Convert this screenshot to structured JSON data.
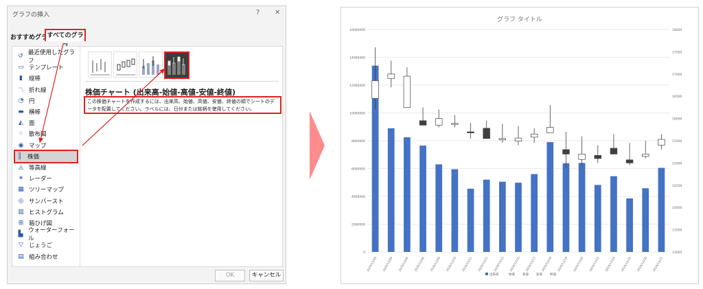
{
  "dialog": {
    "title": "グラフの挿入",
    "help_label": "?",
    "close_label": "✕",
    "tabs": {
      "recommended": "おすすめグラフ",
      "all": "すべてのグラフ"
    },
    "sidebar": [
      {
        "label": "最近使用したグラフ",
        "icon": "recent-icon"
      },
      {
        "label": "テンプレート",
        "icon": "template-icon"
      },
      {
        "label": "縦棒",
        "icon": "column-chart-icon"
      },
      {
        "label": "折れ線",
        "icon": "line-chart-icon"
      },
      {
        "label": "円",
        "icon": "pie-chart-icon"
      },
      {
        "label": "横棒",
        "icon": "bar-chart-icon"
      },
      {
        "label": "面",
        "icon": "area-chart-icon"
      },
      {
        "label": "散布図",
        "icon": "scatter-chart-icon"
      },
      {
        "label": "マップ",
        "icon": "map-chart-icon"
      },
      {
        "label": "株価",
        "icon": "stock-chart-icon"
      },
      {
        "label": "等高線",
        "icon": "surface-chart-icon"
      },
      {
        "label": "レーダー",
        "icon": "radar-chart-icon"
      },
      {
        "label": "ツリーマップ",
        "icon": "treemap-chart-icon"
      },
      {
        "label": "サンバースト",
        "icon": "sunburst-chart-icon"
      },
      {
        "label": "ヒストグラム",
        "icon": "histogram-chart-icon"
      },
      {
        "label": "箱ひげ図",
        "icon": "box-whisker-chart-icon"
      },
      {
        "label": "ウォーターフォール",
        "icon": "waterfall-chart-icon"
      },
      {
        "label": "じょうご",
        "icon": "funnel-chart-icon"
      },
      {
        "label": "組み合わせ",
        "icon": "combo-chart-icon"
      }
    ],
    "selected_category": "株価",
    "subtype_title": "株価チャート (出来高-始値-高値-安値-終値)",
    "description": "この株価チャートを作成するには、出来高、始値、高値、安値、終値の順でシートのデータを配置してください。ラベルには、日付または銘柄を使用してください。",
    "ok_label": "OK",
    "cancel_label": "キャンセル",
    "highlight_color": "#e02020"
  },
  "chart_data": {
    "type": "bar",
    "title": "グラフ タイトル",
    "categories": [
      "2024/12/03",
      "2024/12/04",
      "2024/12/05",
      "2024/12/06",
      "2024/12/09",
      "2024/12/10",
      "2024/12/11",
      "2024/12/12",
      "2024/12/13",
      "2024/12/16",
      "2024/12/17",
      "2024/12/18",
      "2024/12/19",
      "2024/12/20",
      "2024/12/23",
      "2024/12/24",
      "2024/12/25",
      "2024/12/26",
      "2024/12/27"
    ],
    "volume": [
      13400000,
      8900000,
      8250000,
      7650000,
      6300000,
      5950000,
      4550000,
      5200000,
      5050000,
      4980000,
      5600000,
      7900000,
      6380000,
      6400000,
      4820000,
      5450000,
      3850000,
      4580000,
      6050000
    ],
    "open": [
      16450,
      16900,
      16250,
      15950,
      15850,
      15870,
      15700,
      15780,
      15520,
      15490,
      15580,
      15680,
      15300,
      15080,
      15170,
      15330,
      15070,
      15150,
      15400
    ],
    "high": [
      17600,
      17300,
      17150,
      16250,
      16200,
      16080,
      15900,
      15950,
      15880,
      15830,
      15780,
      16300,
      15700,
      15600,
      15400,
      15650,
      15450,
      15500,
      15650
    ],
    "low": [
      16200,
      16700,
      16250,
      15850,
      15800,
      15800,
      15550,
      15580,
      15450,
      15400,
      15450,
      15700,
      14900,
      14950,
      15000,
      15270,
      14950,
      15100,
      15300
    ],
    "close": [
      16850,
      17000,
      16950,
      15850,
      16000,
      15890,
      15690,
      15550,
      15550,
      15560,
      15650,
      15800,
      15200,
      15200,
      15100,
      15200,
      15000,
      15200,
      15530
    ],
    "y_left_ticks": [
      "0",
      "2000000",
      "4000000",
      "6000000",
      "8000000",
      "10000000",
      "12000000",
      "14000000",
      "16000000"
    ],
    "y_right_ticks": [
      "13000",
      "13500",
      "14000",
      "14500",
      "15000",
      "15500",
      "16000",
      "16500",
      "17000",
      "17500",
      "18000"
    ],
    "ylim_left": [
      0,
      16000000
    ],
    "ylim_right": [
      13000,
      18000
    ],
    "legend": [
      "出来高",
      "始値",
      "高値",
      "安値",
      "終値"
    ],
    "volume_color": "#4472c4",
    "up_fill": "#ffffff",
    "down_fill": "#404040",
    "grid": true,
    "legend_position": "bottom"
  },
  "arrow_color": "#ff8c8c"
}
